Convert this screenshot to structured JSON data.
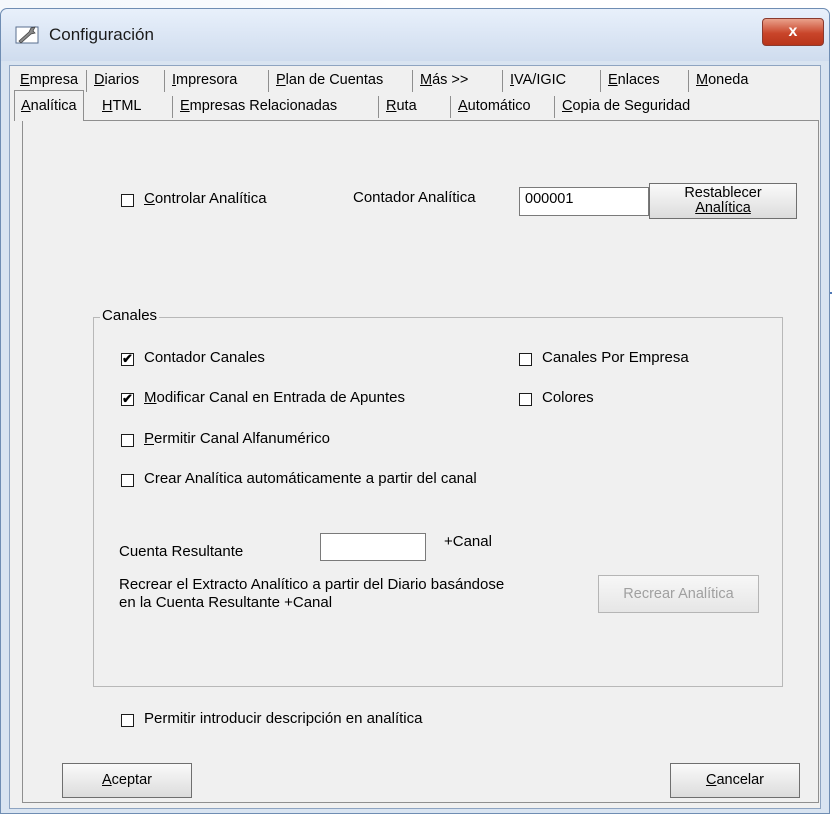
{
  "window": {
    "title": "Configuración",
    "close_glyph": "x"
  },
  "tabs_row1": [
    {
      "label": "Empresa",
      "u": "E",
      "rest": "mpresa"
    },
    {
      "label": "Diarios",
      "u": "D",
      "rest": "iarios"
    },
    {
      "label": "Impresora",
      "u": "I",
      "rest": "mpresora"
    },
    {
      "label": "Plan de Cuentas",
      "u": "P",
      "rest": "lan de Cuentas"
    },
    {
      "label": "Más >>",
      "u": "M",
      "rest": "ás >>"
    },
    {
      "label": "IVA/IGIC",
      "u": "I",
      "rest": "VA/IGIC"
    },
    {
      "label": "Enlaces",
      "u": "E",
      "rest": "nlaces"
    },
    {
      "label": "Moneda",
      "u": "M",
      "rest": "oneda"
    }
  ],
  "tabs_row2": [
    {
      "label": "Analítica",
      "u": "A",
      "rest": "nalítica"
    },
    {
      "label": "HTML",
      "u": "H",
      "rest": "TML"
    },
    {
      "label": "Empresas Relacionadas",
      "u": "E",
      "rest": "mpresas Relacionadas"
    },
    {
      "label": "Ruta",
      "u": "R",
      "rest": "uta"
    },
    {
      "label": "Automático",
      "u": "A",
      "rest": "utomático"
    },
    {
      "label": "Copia de Seguridad",
      "u": "C",
      "rest": "opia de Seguridad"
    }
  ],
  "analitica": {
    "controlar": {
      "u": "C",
      "rest": "ontrolar  Analítica",
      "checked": false
    },
    "contador_label": "Contador  Analítica",
    "contador_value": "000001",
    "restablecer_line1": "Restablecer",
    "restablecer_line2": "Analítica"
  },
  "canales": {
    "group_title": "Canales",
    "contador_canales": {
      "label": "Contador  Canales",
      "checked": true
    },
    "canales_por_empresa": {
      "label": "Canales Por Empresa",
      "checked": false
    },
    "modificar_canal": {
      "u": "M",
      "rest": "odificar Canal en Entrada de Apuntes",
      "checked": true
    },
    "colores": {
      "label": "Colores",
      "checked": false
    },
    "permitir_alfanumerico": {
      "u": "P",
      "rest": "ermitir Canal Alfanumérico",
      "checked": false
    },
    "crear_analitica": {
      "label": "Crear Analítica automáticamente a partir del canal",
      "checked": false
    },
    "cuenta_resultante_label": "Cuenta Resultante",
    "cuenta_resultante_value": "",
    "mas_canal": "+Canal",
    "recrear_text_line1": "Recrear el Extracto Analítico a partir del Diario basándose",
    "recrear_text_line2": "en la Cuenta Resultante +Canal",
    "recrear_button": "Recrear Analítica"
  },
  "permitir_descripcion": {
    "label": "Permitir introducir descripción en analítica",
    "checked": false
  },
  "footer": {
    "aceptar": {
      "u": "A",
      "rest": "ceptar"
    },
    "cancelar": {
      "u": "C",
      "rest": "ancelar"
    }
  },
  "check_glyph": "✔",
  "colors": {
    "arrow": "#4f78b5",
    "close": "#c9452a"
  }
}
